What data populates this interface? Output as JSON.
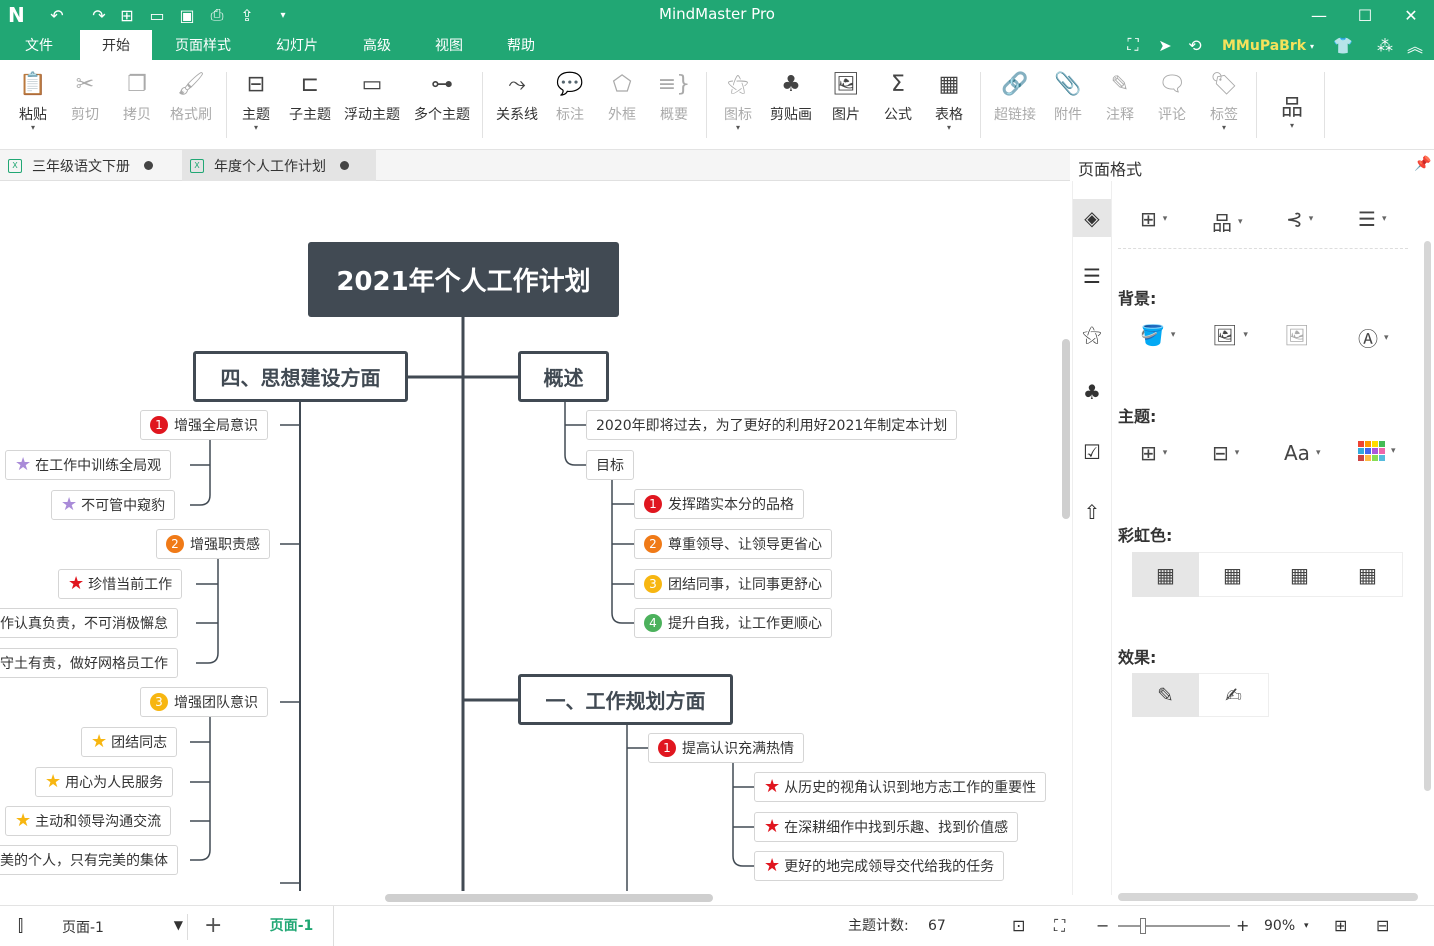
{
  "app": {
    "title": "MindMaster Pro",
    "user": "MMuPaBrk"
  },
  "menu": [
    "文件",
    "开始",
    "页面样式",
    "幻灯片",
    "高级",
    "视图",
    "帮助"
  ],
  "ribbon": {
    "paste": "粘贴",
    "cut": "剪切",
    "copy": "拷贝",
    "format_painter": "格式刷",
    "topic": "主题",
    "subtopic": "子主题",
    "floating": "浮动主题",
    "multiple": "多个主题",
    "relation": "关系线",
    "callout": "标注",
    "boundary": "外框",
    "summary": "概要",
    "icon": "图标",
    "clipart": "剪贴画",
    "picture": "图片",
    "formula": "公式",
    "table": "表格",
    "hyperlink": "超链接",
    "attachment": "附件",
    "note": "注释",
    "comment": "评论",
    "tag": "标签"
  },
  "doc_tabs": [
    "三年级语文下册",
    "年度个人工作计划"
  ],
  "mindmap": {
    "root": "2021年个人工作计划",
    "left_main": "四、思想建设方面",
    "right_main1": "概述",
    "right_main2": "一、工作规划方面",
    "left": [
      {
        "badge": "1",
        "text": "增强全局意识"
      },
      {
        "star": "purple",
        "text": "在工作中训练全局观"
      },
      {
        "star": "purple",
        "text": "不可管中窥豹"
      },
      {
        "badge": "2",
        "text": "增强职责感"
      },
      {
        "star": "red",
        "text": "珍惜当前工作"
      },
      {
        "text": "作认真负责，不可消极懈怠"
      },
      {
        "text": "守土有责，做好网格员工作"
      },
      {
        "badge": "3",
        "text": "增强团队意识"
      },
      {
        "star": "gold",
        "text": "团结同志"
      },
      {
        "star": "gold",
        "text": "用心为人民服务"
      },
      {
        "star": "gold",
        "text": "主动和领导沟通交流"
      },
      {
        "text": "美的个人，只有完美的集体"
      }
    ],
    "overview": [
      {
        "text": "2020年即将过去，为了更好的利用好2021年制定本计划"
      },
      {
        "text": "目标"
      },
      {
        "badge": "1",
        "text": "发挥踏实本分的品格"
      },
      {
        "badge": "2",
        "text": "尊重领导、让领导更省心"
      },
      {
        "badge": "3",
        "text": "团结同事，让同事更舒心"
      },
      {
        "badge": "4",
        "text": "提升自我，让工作更顺心"
      }
    ],
    "plan": [
      {
        "badge": "1",
        "text": "提高认识充满热情"
      },
      {
        "star": "red",
        "text": "从历史的视角认识到地方志工作的重要性"
      },
      {
        "star": "red",
        "text": "在深耕细作中找到乐趣、找到价值感"
      },
      {
        "star": "red",
        "text": "更好的地完成领导交代给我的任务"
      }
    ]
  },
  "panel": {
    "title": "页面格式",
    "background": "背景:",
    "theme": "主题:",
    "rainbow": "彩虹色:",
    "effect": "效果:",
    "font_glyph": "Aa"
  },
  "status": {
    "page_select": "页面-1",
    "page_tab": "页面-1",
    "count_label": "主题计数:",
    "count": "67",
    "zoom": "90%"
  },
  "colors": {
    "accent": "#21a774",
    "node_dark": "#414a53"
  }
}
